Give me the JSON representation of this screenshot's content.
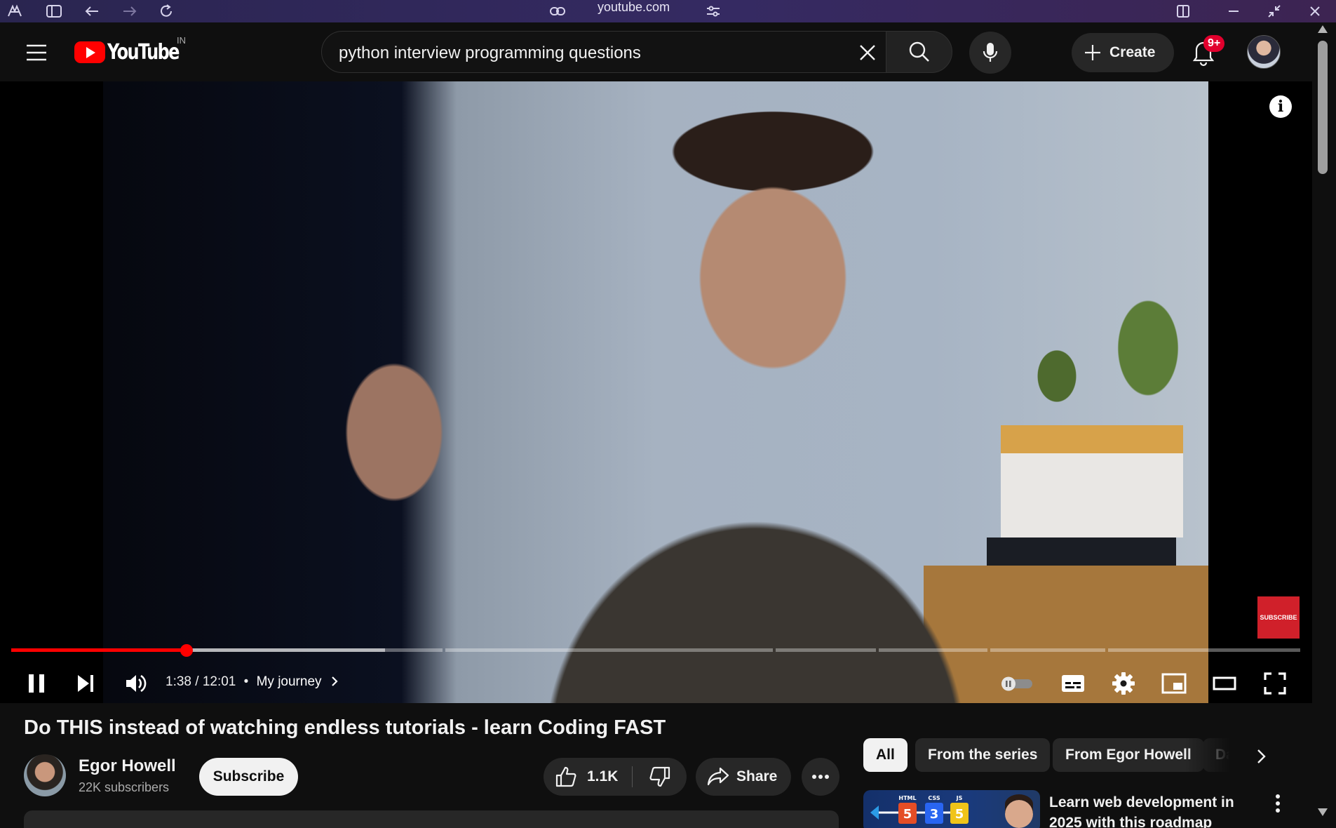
{
  "browser": {
    "url": "youtube.com"
  },
  "masthead": {
    "logo_text": "YouTube",
    "country_code": "IN",
    "search_query": "python interview programming questions",
    "create_label": "Create",
    "notification_badge": "9+"
  },
  "player": {
    "current_time": "1:38",
    "duration": "12:01",
    "time_separator": " / ",
    "chapter_dot": "•",
    "chapter": "My journey",
    "progress_fraction": 0.136,
    "buffered_fraction": 0.29,
    "watermark": "SUBSCRIBE",
    "info_glyph": "i",
    "autoplay_on": false
  },
  "video_info": {
    "title": "Do THIS instead of watching endless tutorials - learn Coding FAST",
    "channel_name": "Egor Howell",
    "subscribers": "22K subscribers",
    "subscribe_label": "Subscribe",
    "likes": "1.1K",
    "share_label": "Share"
  },
  "sidebar": {
    "chips": [
      {
        "label": "All",
        "active": true
      },
      {
        "label": "From the series",
        "active": false
      },
      {
        "label": "From Egor Howell",
        "active": false
      },
      {
        "label": "Da",
        "active": false
      }
    ],
    "recommendation": {
      "title": "Learn web development in 2025 with this roadmap",
      "thumb_badges": [
        "HTML",
        "CSS",
        "JS"
      ]
    }
  },
  "colors": {
    "accent": "#ff0000",
    "background": "#0f0f0f",
    "chip_bg": "#272727",
    "badge": "#e1002d"
  }
}
